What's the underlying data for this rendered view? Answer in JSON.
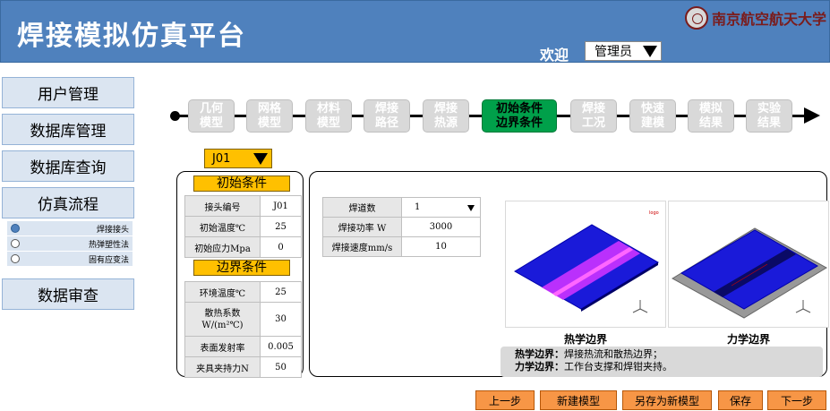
{
  "header": {
    "title": "焊接模拟仿真平台",
    "logo_text": "南京航空航天大学",
    "welcome": "欢迎",
    "user": "管理员"
  },
  "sidebar": {
    "items": [
      "用户管理",
      "数据库管理",
      "数据库查询",
      "仿真流程",
      "数据审查"
    ],
    "sub_items": [
      {
        "label": "焊接接头",
        "selected": true
      },
      {
        "label": "热弹塑性法",
        "selected": false
      },
      {
        "label": "固有应变法",
        "selected": false
      }
    ]
  },
  "workflow": {
    "steps": [
      "几何\n模型",
      "网格\n模型",
      "材料\n模型",
      "焊接\n路径",
      "焊接\n热源",
      "初始条件\n边界条件",
      "焊接\n工况",
      "快速\n建模",
      "模拟\n结果",
      "实验\n结果"
    ],
    "active_index": 5
  },
  "model_select": "J01",
  "initial_conditions": {
    "title": "初始条件",
    "rows": [
      {
        "label": "接头编号",
        "value": "J01"
      },
      {
        "label": "初始温度℃",
        "value": "25"
      },
      {
        "label": "初始应力Mpa",
        "value": "0"
      }
    ]
  },
  "boundary_conditions": {
    "title": "边界条件",
    "rows": [
      {
        "label": "环境温度℃",
        "value": "25"
      },
      {
        "label": "散热系数\nW/(m²℃)",
        "value": "30"
      },
      {
        "label": "表面发射率",
        "value": "0.005"
      },
      {
        "label": "夹具夹持力N",
        "value": "50"
      }
    ]
  },
  "weld_params": {
    "rows": [
      {
        "label": "焊道数",
        "value": "1",
        "dropdown": true
      },
      {
        "label": "焊接功率 W",
        "value": "3000"
      },
      {
        "label": "焊接速度mm/s",
        "value": "10"
      }
    ]
  },
  "views": {
    "thermal_label": "热学边界",
    "mechanical_label": "力学边界"
  },
  "description": {
    "thermal_key": "热学边界：",
    "thermal_text": "焊接热流和散热边界；",
    "mech_key": "力学边界：",
    "mech_text": "工作台支撑和焊钳夹持。"
  },
  "buttons": {
    "prev": "上一步",
    "new_model": "新建模型",
    "save_as": "另存为新模型",
    "save": "保存",
    "next": "下一步"
  },
  "colors": {
    "header": "#4f81bd",
    "active_step": "#00a04a",
    "accent": "#ffc000",
    "button": "#f79646"
  }
}
